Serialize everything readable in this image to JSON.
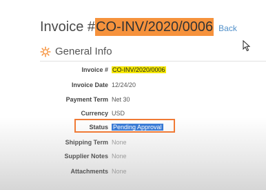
{
  "header": {
    "title_prefix": "Invoice #",
    "invoice_number": "CO-INV/2020/0006",
    "back_label": "Back"
  },
  "section": {
    "title": "General Info",
    "icon": "gear-icon"
  },
  "fields": {
    "invoice_num": {
      "label": "Invoice #",
      "value": "CO-INV/2020/0006"
    },
    "invoice_date": {
      "label": "Invoice Date",
      "value": "12/24/20"
    },
    "payment_term": {
      "label": "Payment Term",
      "value": "Net 30"
    },
    "currency": {
      "label": "Currency",
      "value": "USD"
    },
    "status": {
      "label": "Status",
      "value": "Pending Approval"
    },
    "shipping_term": {
      "label": "Shipping Term",
      "value": "None"
    },
    "supplier_notes": {
      "label": "Supplier Notes",
      "value": "None"
    },
    "attachments": {
      "label": "Attachments",
      "value": "None"
    }
  },
  "colors": {
    "title_highlight": "#f6923c",
    "value_highlight": "#f5e800",
    "status_selection": "#3a7bd5",
    "status_box_border": "#f07a35",
    "link": "#4f8fc9"
  }
}
